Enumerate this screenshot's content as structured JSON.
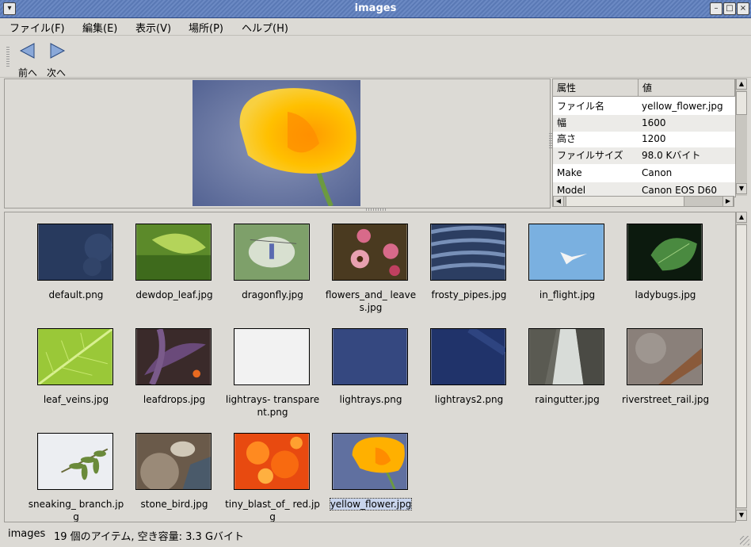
{
  "window": {
    "title": "images"
  },
  "menu": [
    "ファイル(F)",
    "編集(E)",
    "表示(V)",
    "場所(P)",
    "ヘルプ(H)"
  ],
  "toolbar": {
    "prev_label": "前へ",
    "next_label": "次へ"
  },
  "properties": {
    "headers": [
      "属性",
      "値"
    ],
    "rows": [
      {
        "key": "ファイル名",
        "value": "yellow_flower.jpg"
      },
      {
        "key": "幅",
        "value": "1600"
      },
      {
        "key": "高さ",
        "value": "1200"
      },
      {
        "key": "ファイルサイズ",
        "value": "98.0 Kバイト"
      },
      {
        "key": "Make",
        "value": "Canon"
      },
      {
        "key": "Model",
        "value": "Canon EOS D60"
      }
    ]
  },
  "icons": [
    "thumb_default",
    "thumb_dewdrop",
    "thumb_dragonfly",
    "thumb_flowers",
    "thumb_frosty",
    "thumb_flight",
    "thumb_ladybugs",
    "thumb_leafveins",
    "thumb_leafdrops",
    "thumb_lightrays_t",
    "thumb_lightrays",
    "thumb_lightrays2",
    "thumb_raingutter",
    "thumb_riverstreet",
    "thumb_sneaking",
    "thumb_stone",
    "thumb_tiny",
    "thumb_yellow"
  ],
  "files": [
    "default.png",
    "dewdop_leaf.jpg",
    "dragonfly.jpg",
    "flowers_and_ leaves.jpg",
    "frosty_pipes.jpg",
    "in_flight.jpg",
    "ladybugs.jpg",
    "leaf_veins.jpg",
    "leafdrops.jpg",
    "lightrays- transparent.png",
    "lightrays.png",
    "lightrays2.png",
    "raingutter.jpg",
    "riverstreet_rail.jpg",
    "sneaking_ branch.jpg",
    "stone_bird.jpg",
    "tiny_blast_of_ red.jpg",
    "yellow_flower.jpg"
  ],
  "selected_file": "yellow_flower.jpg",
  "status": {
    "location": "images",
    "summary": "19 個のアイテム, 空き容量: 3.3 Gバイト"
  }
}
